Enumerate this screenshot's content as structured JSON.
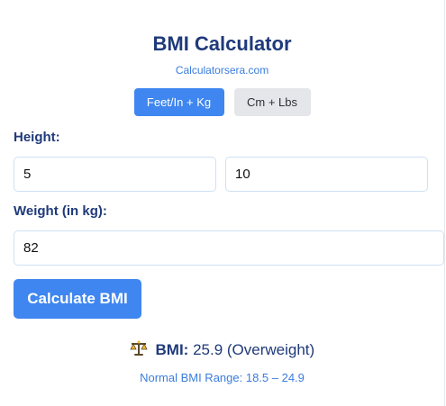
{
  "header": {
    "title": "BMI Calculator",
    "subtitle": "Calculatorsera.com"
  },
  "unit_tabs": [
    {
      "label": "Feet/In + Kg",
      "active": true
    },
    {
      "label": "Cm + Lbs",
      "active": false
    }
  ],
  "form": {
    "height_label": "Height:",
    "height_feet": "5",
    "height_inches": "10",
    "weight_label": "Weight (in kg):",
    "weight_value": "82",
    "calculate_label": "Calculate BMI"
  },
  "result": {
    "icon": "balance-scale-icon",
    "label": "BMI:",
    "value": "25.9 (Overweight)",
    "normal_range": "Normal BMI Range: 18.5 – 24.9"
  },
  "colors": {
    "accent": "#3f86f0",
    "heading": "#1f3a7a",
    "link": "#3b7ddd",
    "tab_inactive": "#e4e6ea"
  }
}
